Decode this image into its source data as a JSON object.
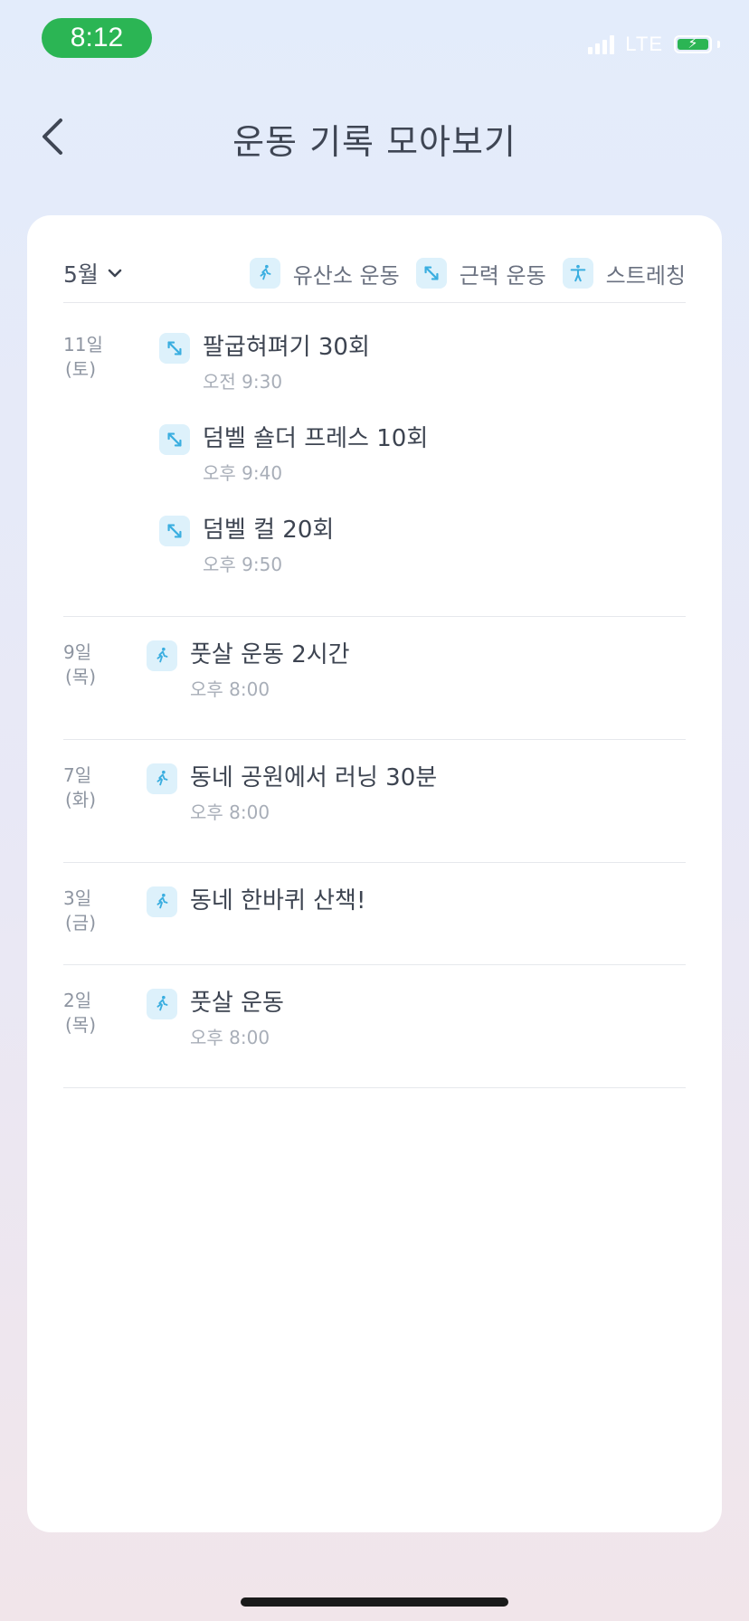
{
  "status_bar": {
    "time": "8:12",
    "network": "LTE"
  },
  "header": {
    "title": "운동 기록 모아보기"
  },
  "filter": {
    "month": "5월",
    "legend": [
      {
        "label": "유산소 운동",
        "icon": "running-icon"
      },
      {
        "label": "근력 운동",
        "icon": "strength-arrow-icon"
      },
      {
        "label": "스트레칭",
        "icon": "stretching-icon"
      }
    ]
  },
  "groups": [
    {
      "day": "11일",
      "weekday": "(토)",
      "entries": [
        {
          "type": "strength",
          "icon": "strength-arrow-icon",
          "name": "팔굽혀펴기 30회",
          "time": "오전 9:30"
        },
        {
          "type": "strength",
          "icon": "strength-arrow-icon",
          "name": "덤벨 숄더 프레스 10회",
          "time": "오후 9:40"
        },
        {
          "type": "strength",
          "icon": "strength-arrow-icon",
          "name": "덤벨 컬 20회",
          "time": "오후 9:50"
        }
      ]
    },
    {
      "day": "9일",
      "weekday": "(목)",
      "entries": [
        {
          "type": "cardio",
          "icon": "running-icon",
          "name": "풋살 운동 2시간",
          "time": "오후 8:00"
        }
      ]
    },
    {
      "day": "7일",
      "weekday": "(화)",
      "entries": [
        {
          "type": "cardio",
          "icon": "running-icon",
          "name": "동네 공원에서 러닝 30분",
          "time": "오후 8:00"
        }
      ]
    },
    {
      "day": "3일",
      "weekday": "(금)",
      "entries": [
        {
          "type": "cardio",
          "icon": "running-icon",
          "name": "동네 한바퀴 산책!",
          "time": ""
        }
      ]
    },
    {
      "day": "2일",
      "weekday": "(목)",
      "entries": [
        {
          "type": "cardio",
          "icon": "running-icon",
          "name": "풋살 운동",
          "time": "오후 8:00"
        }
      ]
    }
  ],
  "colors": {
    "accent": "#3aaee0",
    "icon_bg": "#ddf1fb",
    "status_green": "#2bb554"
  }
}
